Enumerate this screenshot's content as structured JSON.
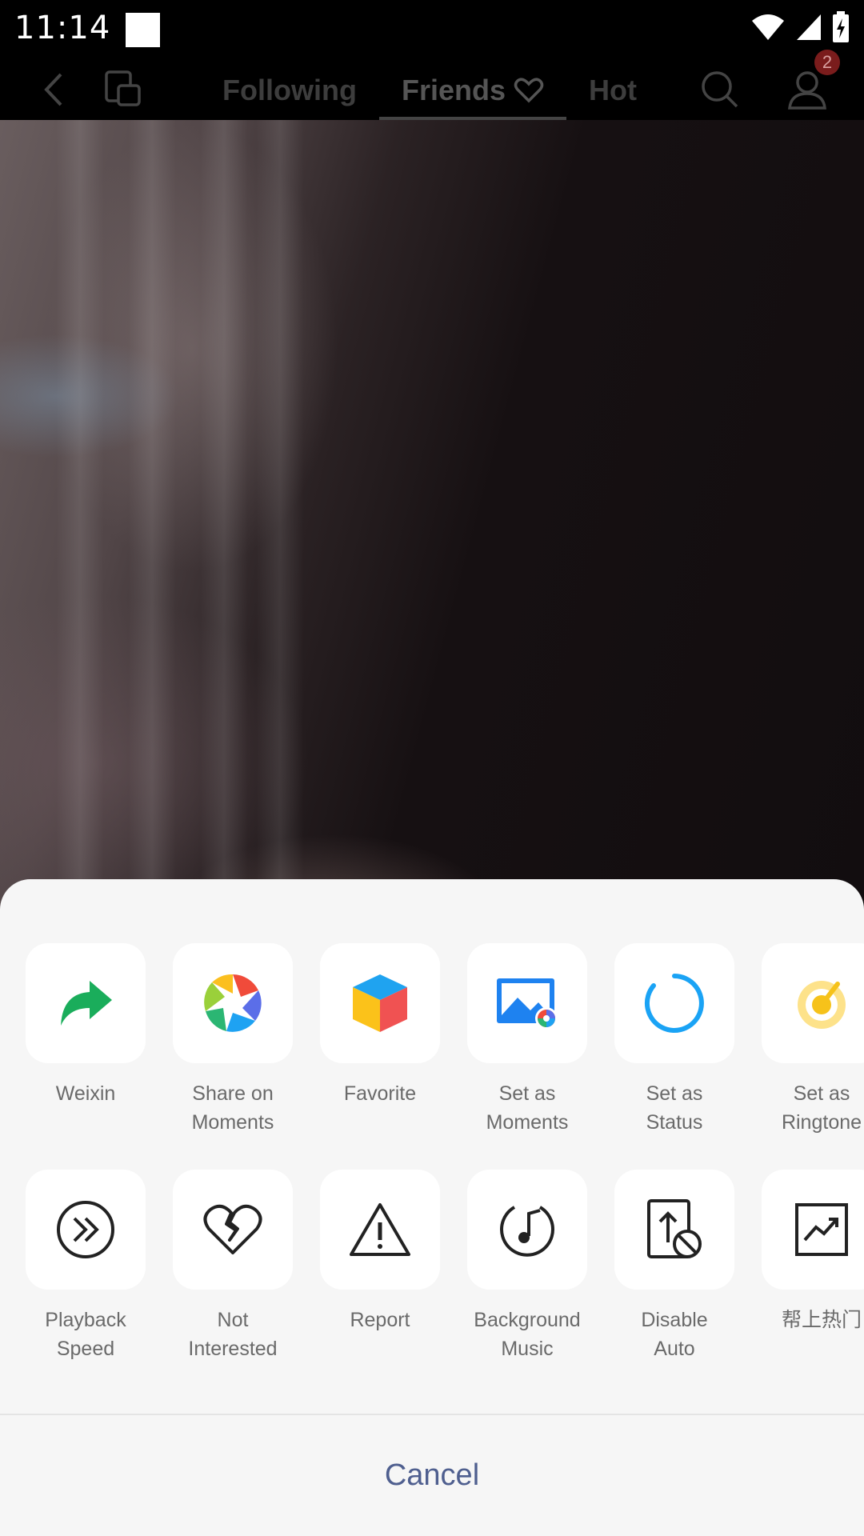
{
  "status_bar": {
    "time": "11:14",
    "icons": [
      "wifi-icon",
      "cellular-signal-icon",
      "battery-charging-icon"
    ]
  },
  "top_nav": {
    "tabs": [
      {
        "label": "Following",
        "active": false
      },
      {
        "label": "Friends",
        "active": true
      },
      {
        "label": "Hot",
        "active": false
      }
    ],
    "notification_count": "2"
  },
  "share_sheet": {
    "row1": [
      {
        "label": "Weixin",
        "icon": "share-arrow-icon"
      },
      {
        "label": "Share on\nMoments",
        "icon": "moments-aperture-icon"
      },
      {
        "label": "Favorite",
        "icon": "favorite-cube-icon"
      },
      {
        "label": "Set as\nMoments",
        "icon": "image-moments-icon"
      },
      {
        "label": "Set as\nStatus",
        "icon": "status-ring-icon"
      },
      {
        "label": "Set as\nRingtone",
        "icon": "ringtone-icon"
      }
    ],
    "row2": [
      {
        "label": "Playback\nSpeed",
        "icon": "playback-speed-icon"
      },
      {
        "label": "Not\nInterested",
        "icon": "broken-heart-icon"
      },
      {
        "label": "Report",
        "icon": "warning-triangle-icon"
      },
      {
        "label": "Background\nMusic",
        "icon": "music-note-icon"
      },
      {
        "label": "Disable\nAuto",
        "icon": "disable-auto-icon"
      },
      {
        "label": "帮上热门",
        "icon": "trending-chart-icon"
      }
    ],
    "cancel_label": "Cancel"
  },
  "colors": {
    "sheet_bg": "#f6f6f6",
    "cancel_text": "#4f5f8f",
    "weixin_green": "#1aad5b",
    "status_blue": "#1aa3f5"
  }
}
